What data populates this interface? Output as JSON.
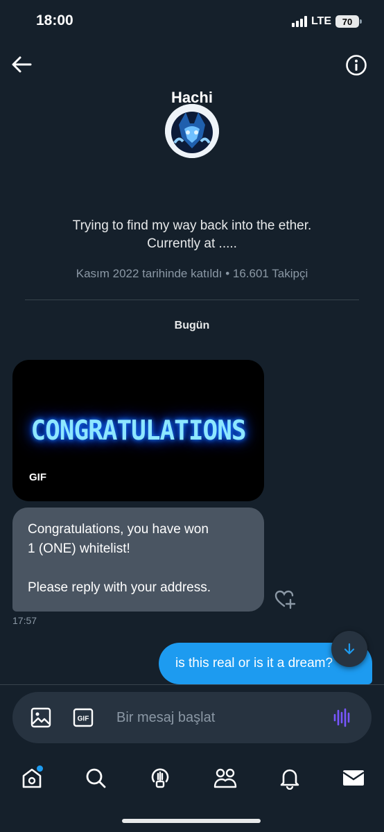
{
  "status_bar": {
    "time": "18:00",
    "network": "LTE",
    "battery": "70"
  },
  "header": {
    "back_icon": "arrow-left-icon",
    "info_icon": "info-circle-icon"
  },
  "profile": {
    "name": "Hachi",
    "bio_lines": [
      "Trying to find my way back into the ether.",
      "Currently at ....."
    ],
    "meta": "Kasım 2022 tarihinde katıldı • 16.601 Takipçi"
  },
  "conversation": {
    "date_label": "Bugün",
    "gif": {
      "text": "CONGRATULATIONS",
      "badge": "GIF"
    },
    "incoming_message": {
      "lines": [
        "Congratulations, you have won",
        "1 (ONE) whitelist!",
        "",
        "Please reply with your address."
      ],
      "time": "17:57"
    },
    "outgoing_message": {
      "text": "is this real or is it a dream?"
    }
  },
  "composer": {
    "placeholder": "Bir mesaj başlat",
    "gif_label": "GIF"
  },
  "tabbar": {
    "items": [
      "home-icon",
      "search-icon",
      "spaces-icon",
      "communities-icon",
      "notifications-icon",
      "messages-icon"
    ]
  },
  "colors": {
    "background": "#15202b",
    "accent": "#1d9bf0",
    "incoming_bubble": "#4a5562",
    "muted_text": "#8b98a5",
    "voice_icon": "#7856ff"
  }
}
